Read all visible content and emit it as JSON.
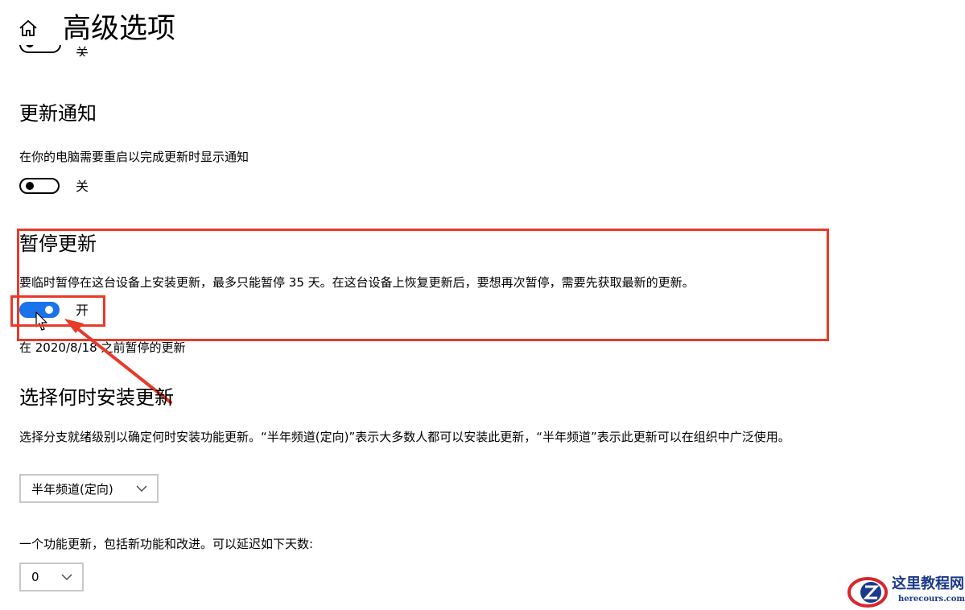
{
  "header": {
    "home_icon": "home-icon",
    "title": "高级选项"
  },
  "top_partial": {
    "toggle_state": "关"
  },
  "update_notifications": {
    "title": "更新通知",
    "description": "在你的电脑需要重启以完成更新时显示通知",
    "toggle_state": "关"
  },
  "pause_updates": {
    "title": "暂停更新",
    "description": "要临时暂停在这台设备上安装更新，最多只能暂停 35 天。在这台设备上恢复更新后，要想再次暂停，需要先获取最新的更新。",
    "toggle_state": "开",
    "toggle_on": true,
    "paused_until": "在 2020/8/18 之前暂停的更新"
  },
  "choose_when": {
    "title": "选择何时安装更新",
    "description": "选择分支就绪级别以确定何时安装功能更新。“半年频道(定向)”表示大多数人都可以安装此更新，“半年频道”表示此更新可以在组织中广泛使用。",
    "branch_select_value": "半年频道(定向)",
    "feature_update_label": "一个功能更新，包括新功能和改进。可以延迟如下天数:",
    "defer_days_value": "0"
  },
  "annotation": {
    "highlight_color": "#e83a2a"
  },
  "watermark": {
    "name": "这里教程网",
    "url": "herecours.com"
  },
  "colors": {
    "toggle_on": "#1a73e8",
    "text": "#000000",
    "select_border": "#c8c8c8"
  }
}
